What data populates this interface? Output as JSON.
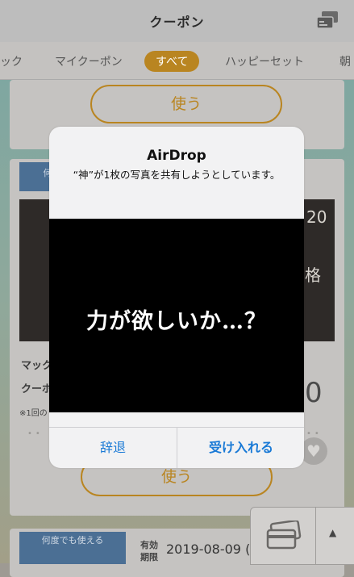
{
  "header": {
    "title": "クーポン",
    "icon": "coupon-cards-icon"
  },
  "tabs": [
    {
      "label": "ック"
    },
    {
      "label": "マイクーポン"
    },
    {
      "label": "すべて",
      "active": true
    },
    {
      "label": "ハッピーセット"
    },
    {
      "label": "朝"
    }
  ],
  "colors": {
    "accent": "#b98521",
    "alert_button": "#1a7ad6",
    "badge_blue": "#4b6f94"
  },
  "cards": {
    "top_use_label": "使う",
    "card2": {
      "badge": "何",
      "price_old": "20",
      "price_label": "格",
      "price_big": "0",
      "title": "マック",
      "subtitle": "クーポ",
      "note": "※1回の",
      "use_label": "使う",
      "heart_icon": "heart-icon"
    },
    "card3": {
      "badge": "何度でも使える",
      "validity_label_1": "有効",
      "validity_label_2": "期限",
      "validity_value": "2019-08-09 ("
    }
  },
  "floating": {
    "wallet_icon": "wallet-cards-icon",
    "up_arrow": "▲"
  },
  "alert": {
    "title": "AirDrop",
    "message": "“神”が1枚の写真を共有しようとしています。",
    "image_text": "力が欲しいか…？",
    "decline_label": "辞退",
    "accept_label": "受け入れる"
  }
}
